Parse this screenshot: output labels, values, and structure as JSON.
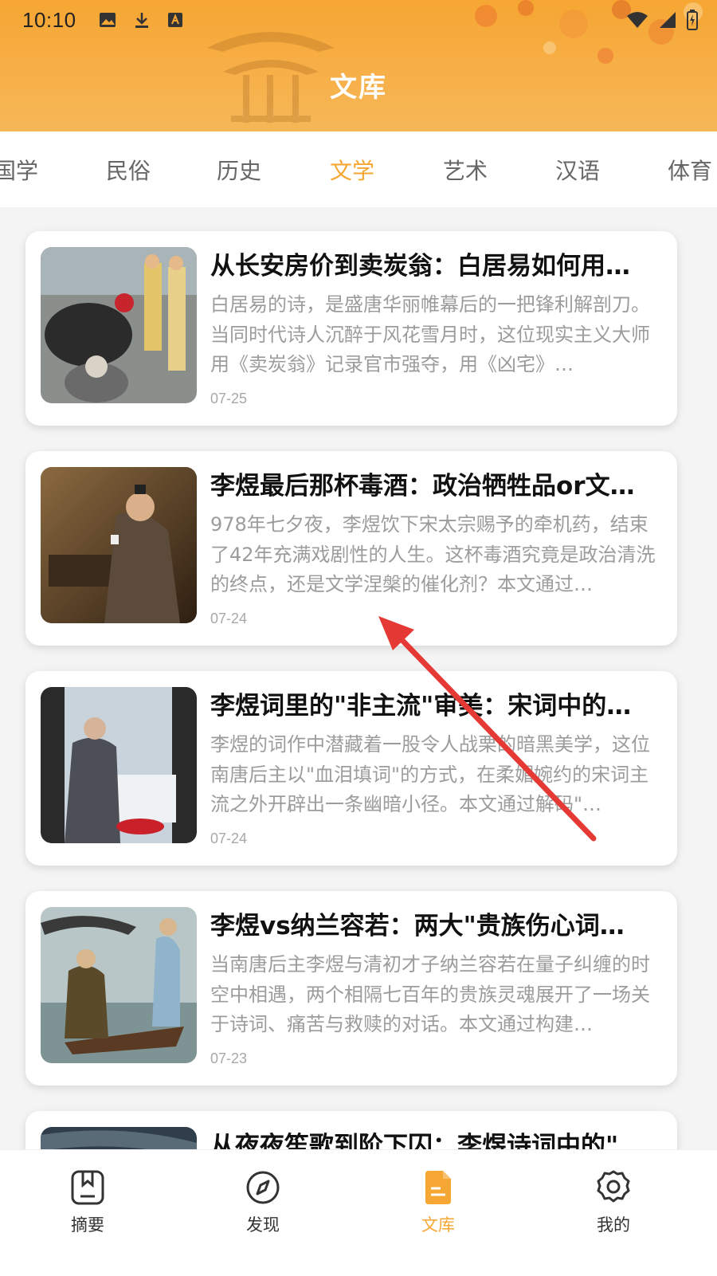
{
  "status": {
    "time": "10:10"
  },
  "header": {
    "title": "文库"
  },
  "tabs": [
    {
      "label": "国学"
    },
    {
      "label": "民俗"
    },
    {
      "label": "历史"
    },
    {
      "label": "文学"
    },
    {
      "label": "艺术"
    },
    {
      "label": "汉语"
    },
    {
      "label": "体育"
    }
  ],
  "active_tab": "文学",
  "articles": [
    {
      "title": "从长安房价到卖炭翁：白居易如何用…",
      "desc": "白居易的诗，是盛唐华丽帷幕后的一把锋利解剖刀。当同时代诗人沉醉于风花雪月时，这位现实主义大师用《卖炭翁》记录官市强夺，用《凶宅》…",
      "date": "07-25"
    },
    {
      "title": "李煜最后那杯毒酒：政治牺牲品or文…",
      "desc": "978年七夕夜，李煜饮下宋太宗赐予的牵机药，结束了42年充满戏剧性的人生。这杯毒酒究竟是政治清洗的终点，还是文学涅槃的催化剂？本文通过…",
      "date": "07-24"
    },
    {
      "title": "李煜词里的\"非主流\"审美：宋词中的…",
      "desc": "李煜的词作中潜藏着一股令人战栗的暗黑美学，这位南唐后主以\"血泪填词\"的方式，在柔媚婉约的宋词主流之外开辟出一条幽暗小径。本文通过解码\"…",
      "date": "07-24"
    },
    {
      "title": "李煜vs纳兰容若：两大\"贵族伤心词…",
      "desc": "当南唐后主李煜与清初才子纳兰容若在量子纠缠的时空中相遇，两个相隔七百年的贵族灵魂展开了一场关于诗词、痛苦与救赎的对话。本文通过构建…",
      "date": "07-23"
    },
    {
      "title": "从夜夜笙歌到阶下囚：李煜诗词中的\"",
      "desc": "",
      "date": ""
    }
  ],
  "nav": [
    {
      "label": "摘要",
      "icon": "bookmark-doc-icon"
    },
    {
      "label": "发现",
      "icon": "compass-icon"
    },
    {
      "label": "文库",
      "icon": "document-icon"
    },
    {
      "label": "我的",
      "icon": "gear-icon"
    }
  ],
  "colors": {
    "accent": "#f6a632",
    "arrow": "#e53935"
  }
}
